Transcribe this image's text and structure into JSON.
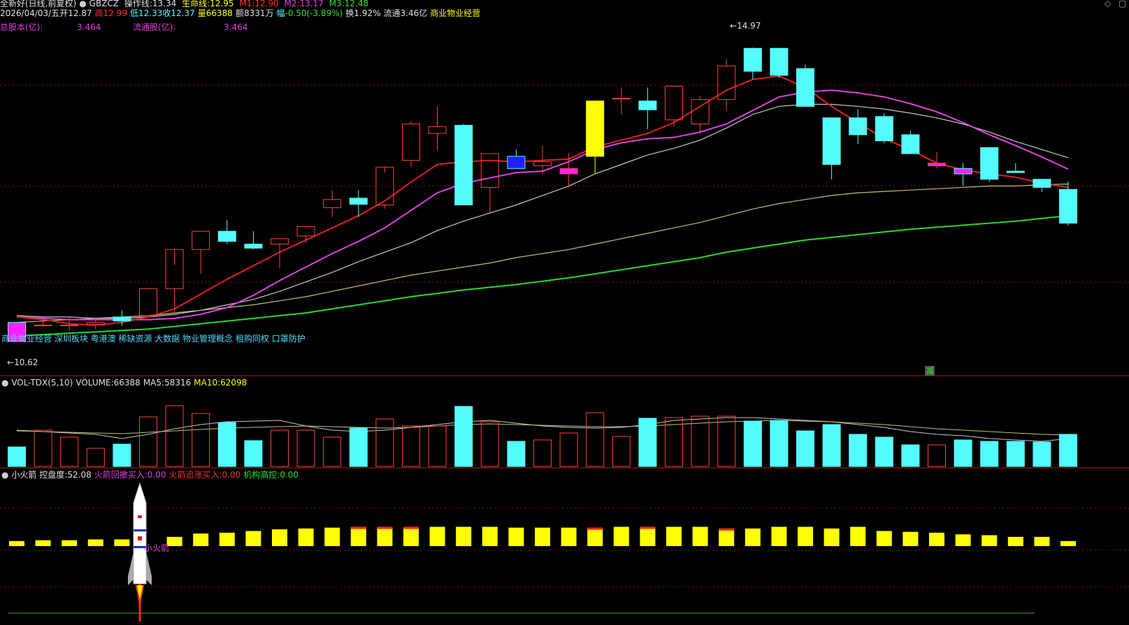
{
  "header": {
    "title": "全新好(日线,前复权)",
    "code": "GBZCZ",
    "czx_label": "操作线:",
    "czx_value": "13.34",
    "smx_label": "生命线:",
    "smx_value": "12.95",
    "m1_label": "M1:",
    "m1_value": "12.90",
    "m2_label": "M2:",
    "m2_value": "13.17",
    "m3_label": "M3:",
    "m3_value": "12.48"
  },
  "quote": {
    "date": "2026/04/03/五",
    "open_label": "开",
    "open": "12.87",
    "high_label": "高",
    "high": "12.99",
    "low_label": "低",
    "low": "12.33",
    "close_label": "收",
    "close": "12.37",
    "vol_label": "量",
    "vol": "66388",
    "amt_label": "额",
    "amt": "8331万",
    "chg_label": "幅",
    "chg": "-0.50(-3.89%)",
    "turn_label": "换",
    "turn": "1.92%",
    "float_label": "流通",
    "float": "3.46亿",
    "industry": "商业物业经营"
  },
  "shares": {
    "total_label": "总股本(亿):",
    "total": "3.464",
    "float_label": "流通股(亿):",
    "float": "3.464"
  },
  "concepts": "商业物业经营 深圳板块 粤港澳 稀缺资源 大数据 物业管理概念 租购同权 口罩防护",
  "price_high_label": "14.97",
  "price_low_label": "10.62",
  "reduce_marker": "减",
  "vol_panel": {
    "name": "VOL-TDX(5,10)",
    "volume_label": "VOLUME:",
    "volume": "66388",
    "ma5_label": "MA5:",
    "ma5": "58316",
    "ma10_label": "MA10:",
    "ma10": "62098"
  },
  "ind_panel": {
    "name": "小火箭",
    "kpd_label": "控盘度:",
    "kpd": "52.08",
    "a_label": "火箭回撤买入:",
    "a": "0.00",
    "b_label": "火箭追涨买入:",
    "b": "0.00",
    "c_label": "机构高控:",
    "c": "0.00",
    "rocket_label": "小火箭"
  },
  "colors": {
    "up": "#ff4040",
    "down": "#54fcfc",
    "red_line": "#e02020",
    "magenta_line": "#e040e0",
    "white_line": "#c8c8c8",
    "tan_line": "#c8bf7a",
    "green_line": "#2ad82a",
    "yellow": "#ffff00"
  },
  "chart_data": {
    "type": "candlestick",
    "ylim": [
      10.4,
      15.2
    ],
    "candles": [
      {
        "o": 10.9,
        "h": 10.9,
        "l": 10.62,
        "c": 10.62,
        "color": "magenta"
      },
      {
        "o": 10.86,
        "h": 10.98,
        "l": 10.84,
        "c": 10.86
      },
      {
        "o": 10.86,
        "h": 10.98,
        "l": 10.78,
        "c": 10.86
      },
      {
        "o": 10.86,
        "h": 10.98,
        "l": 10.8,
        "c": 10.9
      },
      {
        "o": 10.98,
        "h": 11.08,
        "l": 10.85,
        "c": 10.92
      },
      {
        "o": 11.0,
        "h": 11.4,
        "l": 10.98,
        "c": 11.4
      },
      {
        "o": 11.4,
        "h": 11.75,
        "l": 11.0,
        "c": 11.98
      },
      {
        "o": 11.98,
        "h": 12.25,
        "l": 11.62,
        "c": 12.25
      },
      {
        "o": 12.25,
        "h": 12.42,
        "l": 12.06,
        "c": 12.1
      },
      {
        "o": 12.06,
        "h": 12.25,
        "l": 11.98,
        "c": 12.0
      },
      {
        "o": 12.06,
        "h": 12.14,
        "l": 11.7,
        "c": 12.14
      },
      {
        "o": 12.18,
        "h": 12.32,
        "l": 12.08,
        "c": 12.32
      },
      {
        "o": 12.6,
        "h": 12.86,
        "l": 12.46,
        "c": 12.72
      },
      {
        "o": 12.74,
        "h": 12.86,
        "l": 12.46,
        "c": 12.65
      },
      {
        "o": 12.64,
        "h": 13.12,
        "l": 12.58,
        "c": 13.2
      },
      {
        "o": 13.3,
        "h": 13.88,
        "l": 13.2,
        "c": 13.84
      },
      {
        "o": 13.7,
        "h": 14.1,
        "l": 13.44,
        "c": 13.8
      },
      {
        "o": 13.82,
        "h": 13.84,
        "l": 12.64,
        "c": 12.64
      },
      {
        "o": 12.9,
        "h": 13.4,
        "l": 12.52,
        "c": 13.4
      },
      {
        "o": 13.36,
        "h": 13.46,
        "l": 13.22,
        "c": 13.18,
        "color": "blue"
      },
      {
        "o": 13.22,
        "h": 13.52,
        "l": 13.1,
        "c": 13.28
      },
      {
        "o": 13.1,
        "h": 13.4,
        "l": 12.9,
        "c": 13.18,
        "color": "magenta"
      },
      {
        "o": 13.36,
        "h": 14.18,
        "l": 13.1,
        "c": 14.18,
        "color": "yellow"
      },
      {
        "o": 14.22,
        "h": 14.38,
        "l": 13.98,
        "c": 14.22,
        "color": "blue"
      },
      {
        "o": 14.18,
        "h": 14.38,
        "l": 13.76,
        "c": 14.05
      },
      {
        "o": 13.9,
        "h": 14.4,
        "l": 13.8,
        "c": 14.4
      },
      {
        "o": 13.84,
        "h": 14.26,
        "l": 13.7,
        "c": 14.2
      },
      {
        "o": 14.2,
        "h": 14.8,
        "l": 14.04,
        "c": 14.7
      },
      {
        "o": 14.96,
        "h": 14.97,
        "l": 14.5,
        "c": 14.62
      },
      {
        "o": 14.96,
        "h": 14.97,
        "l": 14.52,
        "c": 14.56
      },
      {
        "o": 14.66,
        "h": 14.72,
        "l": 14.1,
        "c": 14.1
      },
      {
        "o": 13.93,
        "h": 13.93,
        "l": 13.02,
        "c": 13.24
      },
      {
        "o": 13.93,
        "h": 14.06,
        "l": 13.54,
        "c": 13.68
      },
      {
        "o": 13.95,
        "h": 14.0,
        "l": 13.55,
        "c": 13.59
      },
      {
        "o": 13.68,
        "h": 13.74,
        "l": 13.4,
        "c": 13.4
      },
      {
        "o": 13.22,
        "h": 13.42,
        "l": 13.18,
        "c": 13.26,
        "color": "magenta"
      },
      {
        "o": 13.18,
        "h": 13.26,
        "l": 12.92,
        "c": 13.1,
        "color": "magenta"
      },
      {
        "o": 13.49,
        "h": 13.49,
        "l": 12.98,
        "c": 13.02
      },
      {
        "o": 13.14,
        "h": 13.26,
        "l": 13.12,
        "c": 13.12
      },
      {
        "o": 13.02,
        "h": 13.02,
        "l": 12.83,
        "c": 12.9
      },
      {
        "o": 12.87,
        "h": 12.99,
        "l": 12.33,
        "c": 12.37
      }
    ],
    "ma_red": [
      10.98,
      10.94,
      10.88,
      10.86,
      10.9,
      10.98,
      11.1,
      11.32,
      11.54,
      11.74,
      11.94,
      12.12,
      12.3,
      12.48,
      12.7,
      12.98,
      13.24,
      13.28,
      13.3,
      13.28,
      13.3,
      13.32,
      13.5,
      13.6,
      13.7,
      13.86,
      14.1,
      14.34,
      14.5,
      14.55,
      14.38,
      14.1,
      13.86,
      13.62,
      13.46,
      13.26,
      13.16,
      13.1,
      13.05,
      12.96,
      12.9
    ],
    "ma_magenta": [
      10.98,
      10.96,
      10.94,
      10.94,
      10.94,
      10.94,
      10.96,
      11.02,
      11.12,
      11.3,
      11.52,
      11.72,
      11.92,
      12.1,
      12.3,
      12.56,
      12.82,
      12.96,
      13.04,
      13.12,
      13.14,
      13.28,
      13.46,
      13.56,
      13.62,
      13.64,
      13.72,
      13.84,
      14.04,
      14.24,
      14.31,
      14.34,
      14.3,
      14.24,
      14.14,
      14.02,
      13.86,
      13.68,
      13.52,
      13.35,
      13.17
    ],
    "ma_white": [
      11.0,
      10.98,
      10.98,
      10.96,
      10.96,
      10.98,
      11.02,
      11.08,
      11.16,
      11.24,
      11.36,
      11.5,
      11.64,
      11.8,
      11.94,
      12.08,
      12.26,
      12.4,
      12.52,
      12.64,
      12.78,
      12.92,
      13.1,
      13.24,
      13.38,
      13.48,
      13.6,
      13.78,
      13.98,
      14.1,
      14.13,
      14.13,
      14.1,
      14.06,
      14.0,
      13.93,
      13.84,
      13.72,
      13.58,
      13.46,
      13.34
    ],
    "ma_tan": [
      10.9,
      10.92,
      10.94,
      10.96,
      10.98,
      11.0,
      11.04,
      11.08,
      11.12,
      11.16,
      11.22,
      11.28,
      11.36,
      11.44,
      11.52,
      11.6,
      11.66,
      11.72,
      11.78,
      11.86,
      11.92,
      11.98,
      12.06,
      12.14,
      12.22,
      12.3,
      12.38,
      12.48,
      12.58,
      12.66,
      12.72,
      12.78,
      12.82,
      12.84,
      12.86,
      12.88,
      12.9,
      12.92,
      12.92,
      12.94,
      12.95
    ],
    "ma_green": [
      10.7,
      10.72,
      10.74,
      10.76,
      10.78,
      10.8,
      10.84,
      10.88,
      10.92,
      10.96,
      11.0,
      11.04,
      11.1,
      11.16,
      11.22,
      11.28,
      11.33,
      11.38,
      11.42,
      11.46,
      11.51,
      11.56,
      11.62,
      11.68,
      11.74,
      11.8,
      11.86,
      11.94,
      12.0,
      12.06,
      12.12,
      12.16,
      12.2,
      12.24,
      12.28,
      12.31,
      12.34,
      12.37,
      12.4,
      12.44,
      12.48
    ],
    "volume": [
      28000,
      52000,
      42000,
      26000,
      32000,
      71000,
      87000,
      76000,
      63000,
      37000,
      52000,
      52000,
      42000,
      55000,
      68000,
      58000,
      58000,
      86000,
      64000,
      36000,
      38000,
      48000,
      77000,
      43000,
      69000,
      70000,
      72000,
      72000,
      65000,
      66000,
      51000,
      60000,
      46000,
      42000,
      31000,
      31000,
      38000,
      36000,
      36000,
      35000,
      46000
    ],
    "vol_ma5": [
      52000,
      50000,
      48000,
      46000,
      40000,
      46000,
      54000,
      60000,
      64000,
      65000,
      66000,
      58000,
      52000,
      50000,
      52000,
      56000,
      60000,
      64000,
      66000,
      62000,
      58000,
      56000,
      55000,
      56000,
      60000,
      66000,
      68000,
      70000,
      70000,
      68000,
      66000,
      64000,
      60000,
      56000,
      50000,
      46000,
      44000,
      40000,
      38000,
      36000,
      40000
    ],
    "vol_ma10": [
      51000,
      50000,
      49000,
      48000,
      47000,
      49000,
      51000,
      53000,
      55000,
      56000,
      57000,
      58000,
      57000,
      56000,
      55000,
      56000,
      58000,
      60000,
      61000,
      60000,
      59000,
      58000,
      57000,
      57000,
      58000,
      60000,
      62000,
      64000,
      65000,
      66000,
      65000,
      64000,
      62000,
      60000,
      57000,
      54000,
      52000,
      50000,
      48000,
      46000,
      45000
    ],
    "kpd": [
      52.1,
      52.2,
      52.2,
      52.3,
      52.3,
      52.5,
      52.6,
      53.0,
      53.1,
      53.3,
      53.5,
      53.6,
      53.7,
      53.8,
      53.8,
      53.8,
      53.8,
      53.8,
      53.8,
      53.7,
      53.7,
      53.7,
      53.7,
      53.8,
      53.8,
      53.8,
      53.8,
      53.6,
      53.6,
      53.8,
      53.8,
      53.6,
      53.8,
      53.3,
      53.2,
      53.1,
      52.9,
      52.8,
      52.6,
      52.6,
      52.1
    ],
    "kpd_red": [
      false,
      false,
      false,
      false,
      false,
      false,
      false,
      false,
      false,
      false,
      false,
      false,
      false,
      true,
      true,
      true,
      false,
      false,
      false,
      false,
      false,
      false,
      true,
      false,
      true,
      false,
      false,
      true,
      false,
      false,
      false,
      false,
      false,
      false,
      false,
      false,
      false,
      false,
      false,
      false,
      false
    ]
  }
}
